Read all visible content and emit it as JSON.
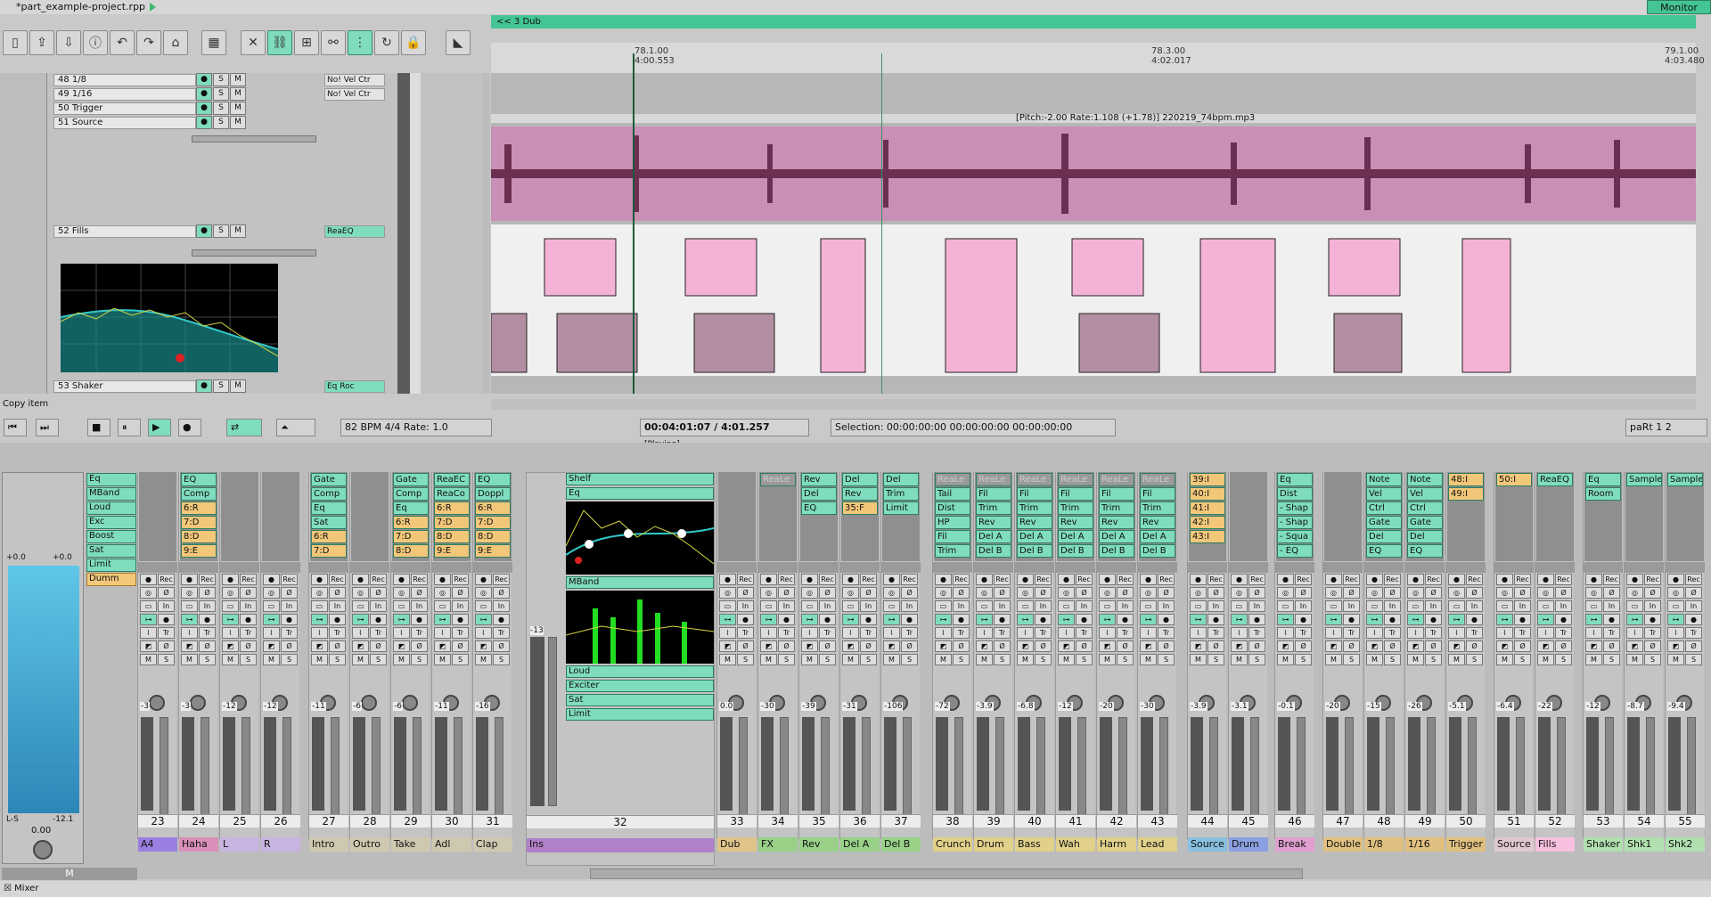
{
  "window": {
    "title": "*part_example-project.rpp",
    "monitor_label": "Monitor"
  },
  "region": {
    "label": "<< 3 Dub"
  },
  "ruler": {
    "marks": [
      {
        "bar": "78.1.00",
        "time": "4:00.553"
      },
      {
        "bar": "78.3.00",
        "time": "4:02.017"
      },
      {
        "bar": "79.1.00",
        "time": "4:03.480"
      }
    ]
  },
  "tracks": [
    {
      "num": "48",
      "name": "1/8",
      "fx": "No!",
      "fx2": "Vel",
      "fx3": "Ctr"
    },
    {
      "num": "49",
      "name": "1/16",
      "fx": "No!",
      "fx2": "Vel",
      "fx3": "Ctr"
    },
    {
      "num": "50",
      "name": "Trigger",
      "fx": "",
      "fx2": "",
      "fx3": ""
    },
    {
      "num": "51",
      "name": "Source",
      "fx": "",
      "fx2": "",
      "fx3": ""
    },
    {
      "num": "52",
      "name": "Fills",
      "fx": "ReaEQ",
      "fx2": "",
      "fx3": ""
    },
    {
      "num": "53",
      "name": "Shaker",
      "fx": "Eq",
      "fx2": "Roc",
      "fx3": ""
    }
  ],
  "item_label": "[Pitch:-2.00 Rate:1.108 (+1.78)] 220219_74bpm.mp3",
  "action_hint": "Copy item",
  "transport": {
    "bpm": "82",
    "bpm_label": "BPM",
    "time_sig": "4/4",
    "rate_label": "Rate:",
    "rate": "1.0",
    "position": "00:04:01:07 / 4:01.257",
    "state": "[Playing]",
    "selection_label": "Selection:",
    "sel_start": "00:00:00:00",
    "sel_end": "00:00:00:00",
    "sel_len": "00:00:00:00",
    "part_label": "paRt",
    "page1": "1",
    "page2": "2"
  },
  "master": {
    "vol_l": "+0.0",
    "vol_r": "+0.0",
    "lr": "L-S",
    "peak": "-12.1",
    "pan": "0.00",
    "label": "M",
    "fx": [
      "Eq",
      "MBand",
      "Loud",
      "Exc",
      "Boost",
      "Sat",
      "Limit",
      "Dumm"
    ]
  },
  "ins_strip": {
    "num": "32",
    "name": "Ins",
    "fx": [
      "Shelf",
      "Eq",
      "MBand",
      "Loud",
      "Exciter",
      "Sat",
      "Limit"
    ],
    "vol": "-13"
  },
  "strips": [
    {
      "num": "23",
      "name": "A4",
      "vol": "-3",
      "fx": []
    },
    {
      "num": "24",
      "name": "Haha",
      "vol": "-3",
      "fx": [
        "EQ",
        "Comp",
        "6:R",
        "7:D",
        "8:D",
        "9:E"
      ]
    },
    {
      "num": "25",
      "name": "L",
      "vol": "-12",
      "fx": []
    },
    {
      "num": "26",
      "name": "R",
      "vol": "-12",
      "fx": []
    },
    {
      "num": "27",
      "name": "Intro",
      "vol": "-11",
      "fx": [
        "Gate",
        "Comp",
        "Eq",
        "Sat",
        "6:R",
        "7:D"
      ]
    },
    {
      "num": "28",
      "name": "Outro",
      "vol": "-6",
      "fx": []
    },
    {
      "num": "29",
      "name": "Take",
      "vol": "-6",
      "fx": [
        "Gate",
        "Comp",
        "Eq",
        "6:R",
        "7:D",
        "8:D"
      ]
    },
    {
      "num": "30",
      "name": "Adl",
      "vol": "-11",
      "fx": [
        "ReaEC",
        "ReaCo",
        "6:R",
        "7:D",
        "8:D",
        "9:E"
      ]
    },
    {
      "num": "31",
      "name": "Clap",
      "vol": "-16",
      "fx": [
        "EQ",
        "Doppl",
        "6:R",
        "7:D",
        "8:D",
        "9:E"
      ]
    },
    {
      "num": "33",
      "name": "Dub",
      "vol": "0.0",
      "fx": []
    },
    {
      "num": "34",
      "name": "FX",
      "vol": "-30",
      "fx": [
        "ReaLe"
      ]
    },
    {
      "num": "35",
      "name": "Rev",
      "vol": "-39",
      "fx": [
        "Rev",
        "Del",
        "EQ"
      ]
    },
    {
      "num": "36",
      "name": "Del A",
      "vol": "-31",
      "fx": [
        "Del",
        "Rev",
        "35:F"
      ]
    },
    {
      "num": "37",
      "name": "Del B",
      "vol": "-106",
      "fx": [
        "Del",
        "Trim",
        "Limit"
      ]
    },
    {
      "num": "38",
      "name": "Crunch",
      "vol": "-72",
      "fx": [
        "ReaLe",
        "Tail",
        "Dist",
        "HP",
        "Fil",
        "Trim"
      ]
    },
    {
      "num": "39",
      "name": "Drum",
      "vol": "-3.9",
      "fx": [
        "ReaLe",
        "Fil",
        "Trim",
        "Rev",
        "Del A",
        "Del B"
      ]
    },
    {
      "num": "40",
      "name": "Bass",
      "vol": "-6.8",
      "fx": [
        "ReaLe",
        "Fil",
        "Trim",
        "Rev",
        "Del A",
        "Del B"
      ]
    },
    {
      "num": "41",
      "name": "Wah",
      "vol": "-12",
      "fx": [
        "ReaLe",
        "Fil",
        "Trim",
        "Rev",
        "Del A",
        "Del B"
      ]
    },
    {
      "num": "42",
      "name": "Harm",
      "vol": "-20",
      "fx": [
        "ReaLe",
        "Fil",
        "Trim",
        "Rev",
        "Del A",
        "Del B"
      ]
    },
    {
      "num": "43",
      "name": "Lead",
      "vol": "-30",
      "fx": [
        "ReaLe",
        "Fil",
        "Trim",
        "Rev",
        "Del A",
        "Del B"
      ]
    },
    {
      "num": "44",
      "name": "Source",
      "vol": "-3.9",
      "fx": [
        "39:I",
        "40:I",
        "41:I",
        "42:I",
        "43:I"
      ]
    },
    {
      "num": "45",
      "name": "Drum",
      "vol": "-3.1",
      "fx": []
    },
    {
      "num": "46",
      "name": "Break",
      "vol": "-0.1",
      "fx": [
        "Eq",
        "Dist",
        "- Shap",
        "- Shap",
        "- Squa",
        "- EQ"
      ]
    },
    {
      "num": "47",
      "name": "Double",
      "vol": "-20",
      "fx": []
    },
    {
      "num": "48",
      "name": "1/8",
      "vol": "-15",
      "fx": [
        "Note",
        "Vel",
        "Ctrl",
        "Gate",
        "Del",
        "EQ"
      ]
    },
    {
      "num": "49",
      "name": "1/16",
      "vol": "-26",
      "fx": [
        "Note",
        "Vel",
        "Ctrl",
        "Gate",
        "Del",
        "EQ"
      ]
    },
    {
      "num": "50",
      "name": "Trigger",
      "vol": "-5.1",
      "fx": [
        "48:I",
        "49:I"
      ]
    },
    {
      "num": "51",
      "name": "Source",
      "vol": "-6.4",
      "fx": [
        "50:I"
      ]
    },
    {
      "num": "52",
      "name": "Fills",
      "vol": "-22",
      "fx": [
        "ReaEQ"
      ]
    },
    {
      "num": "53",
      "name": "Shaker",
      "vol": "-12",
      "fx": [
        "Eq",
        "Room"
      ]
    },
    {
      "num": "54",
      "name": "Shk1",
      "vol": "-8.7",
      "fx": [
        "Sample"
      ]
    },
    {
      "num": "55",
      "name": "Shk2",
      "vol": "-9.4",
      "fx": [
        "Sample"
      ]
    }
  ],
  "status": {
    "mixer_label": "Mixer"
  }
}
